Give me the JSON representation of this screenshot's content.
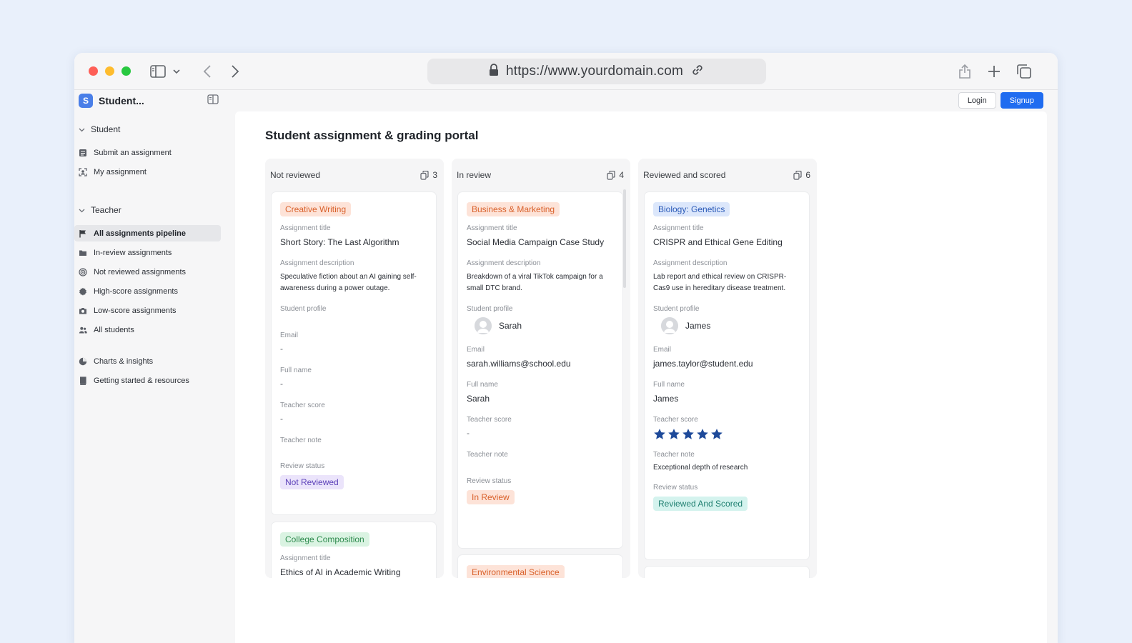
{
  "browser": {
    "url": "https://www.yourdomain.com"
  },
  "app": {
    "name": "Student...",
    "logo_letter": "S",
    "login_label": "Login",
    "signup_label": "Signup",
    "page_title": "Student assignment & grading portal"
  },
  "sidebar": {
    "student_section": "Student",
    "student_items": [
      {
        "label": "Submit an assignment",
        "icon": "form-icon"
      },
      {
        "label": "My assignment",
        "icon": "target-user-icon"
      }
    ],
    "teacher_section": "Teacher",
    "teacher_items": [
      {
        "label": "All assignments pipeline",
        "icon": "flag-icon",
        "active": true
      },
      {
        "label": "In-review assignments",
        "icon": "folder-icon"
      },
      {
        "label": "Not reviewed assignments",
        "icon": "target-icon"
      },
      {
        "label": "High-score assignments",
        "icon": "badge-icon"
      },
      {
        "label": "Low-score assignments",
        "icon": "camera-icon"
      },
      {
        "label": "All students",
        "icon": "users-icon"
      }
    ],
    "other_items": [
      {
        "label": "Charts & insights",
        "icon": "chart-icon"
      },
      {
        "label": "Getting started & resources",
        "icon": "book-icon"
      }
    ]
  },
  "labels": {
    "assignment_title": "Assignment title",
    "assignment_description": "Assignment description",
    "student_profile": "Student profile",
    "email": "Email",
    "full_name": "Full name",
    "teacher_score": "Teacher score",
    "teacher_note": "Teacher note",
    "review_status": "Review status",
    "empty": "-"
  },
  "columns": [
    {
      "title": "Not reviewed",
      "count": "3",
      "cards": [
        {
          "subject": "Creative Writing",
          "title": "Short Story: The Last Algorithm",
          "description": "Speculative fiction about an AI gaining self-awareness during a power outage.",
          "student": "",
          "email": "-",
          "full_name": "-",
          "score": "-",
          "note": "",
          "status": "Not Reviewed"
        },
        {
          "subject": "College Composition",
          "title": "Ethics of AI in Academic Writing"
        }
      ]
    },
    {
      "title": "In review",
      "count": "4",
      "cards": [
        {
          "subject": "Business & Marketing",
          "title": "Social Media Campaign Case Study",
          "description": "Breakdown of a viral TikTok campaign for a small DTC brand.",
          "student": "Sarah",
          "email": "sarah.williams@school.edu",
          "full_name": "Sarah",
          "score": "-",
          "note": "",
          "status": "In Review"
        },
        {
          "subject": "Environmental Science"
        }
      ]
    },
    {
      "title": "Reviewed and scored",
      "count": "6",
      "cards": [
        {
          "subject": "Biology: Genetics",
          "title": "CRISPR and Ethical Gene Editing",
          "description": "Lab report and ethical review on CRISPR-Cas9 use in hereditary disease treatment.",
          "student": "James",
          "email": "james.taylor@student.edu",
          "full_name": "James",
          "score_stars": 5,
          "note": "Exceptional depth of research",
          "status": "Reviewed And Scored"
        }
      ]
    }
  ],
  "colors": {
    "accent": "#1f6cf0",
    "star": "#1e4a9a",
    "background": "#e9f0fb"
  }
}
